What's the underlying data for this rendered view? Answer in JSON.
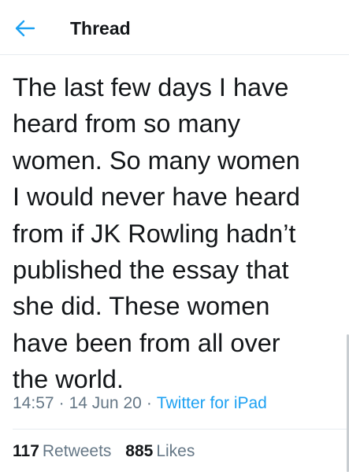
{
  "header": {
    "back_icon": "arrow-left-icon",
    "title": "Thread"
  },
  "tweet": {
    "lines": [
      "The last few days I have",
      "heard from so many",
      "women. So many women",
      "I would never have heard",
      "from if JK Rowling hadn’t",
      "published the essay that",
      "she did. These women",
      "have been from all over",
      "the world."
    ],
    "time": "14:57",
    "date": "14 Jun 20",
    "separator": "·",
    "source": "Twitter for iPad"
  },
  "stats": {
    "retweets_count": "117",
    "retweets_label": "Retweets",
    "likes_count": "885",
    "likes_label": "Likes"
  },
  "colors": {
    "accent": "#1da1f2",
    "text_primary": "#14171a",
    "text_secondary": "#657786",
    "divider": "#e6ecf0"
  }
}
